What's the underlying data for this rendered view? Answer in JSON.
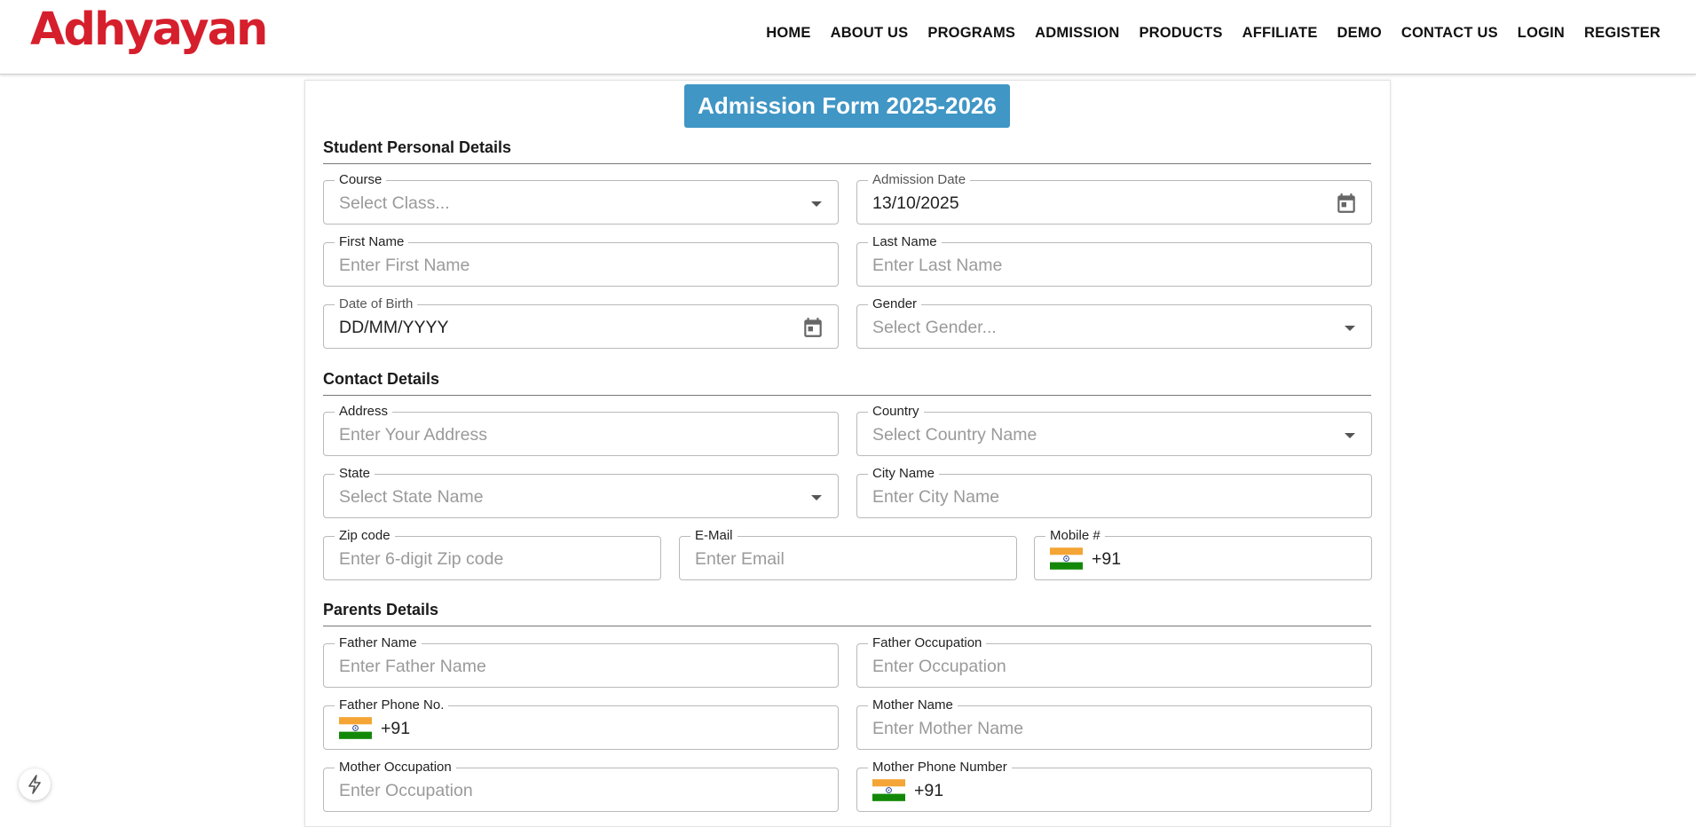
{
  "brand": {
    "logo_text": "Adhyayan",
    "color": "#d61f2c"
  },
  "nav": [
    "HOME",
    "ABOUT US",
    "PROGRAMS",
    "ADMISSION",
    "PRODUCTS",
    "AFFILIATE",
    "DEMO",
    "CONTACT US",
    "LOGIN",
    "REGISTER"
  ],
  "form_title": "Admission Form 2025-2026",
  "accent_color": "#4096c5",
  "sections": {
    "personal": {
      "title": "Student Personal Details",
      "course": {
        "label": "Course",
        "placeholder": "Select Class..."
      },
      "admission_date": {
        "label": "Admission Date",
        "value": "13/10/2025"
      },
      "first_name": {
        "label": "First Name",
        "placeholder": "Enter First Name"
      },
      "last_name": {
        "label": "Last Name",
        "placeholder": "Enter Last Name"
      },
      "dob": {
        "label": "Date of Birth",
        "value": "DD/MM/YYYY"
      },
      "gender": {
        "label": "Gender",
        "placeholder": "Select Gender..."
      }
    },
    "contact": {
      "title": "Contact Details",
      "address": {
        "label": "Address",
        "placeholder": "Enter Your Address"
      },
      "country": {
        "label": "Country",
        "placeholder": "Select Country Name"
      },
      "state": {
        "label": "State",
        "placeholder": "Select State Name"
      },
      "city": {
        "label": "City Name",
        "placeholder": "Enter City Name"
      },
      "zip": {
        "label": "Zip code",
        "placeholder": "Enter 6-digit Zip code"
      },
      "email": {
        "label": "E-Mail",
        "placeholder": "Enter Email"
      },
      "mobile": {
        "label": "Mobile #",
        "code": "+91"
      }
    },
    "parents": {
      "title": "Parents Details",
      "father_name": {
        "label": "Father Name",
        "placeholder": "Enter Father Name"
      },
      "father_occupation": {
        "label": "Father Occupation",
        "placeholder": "Enter Occupation"
      },
      "father_phone": {
        "label": "Father Phone No.",
        "code": "+91"
      },
      "mother_name": {
        "label": "Mother Name",
        "placeholder": "Enter Mother Name"
      },
      "mother_occupation": {
        "label": "Mother Occupation",
        "placeholder": "Enter Occupation"
      },
      "mother_phone": {
        "label": "Mother Phone Number",
        "code": "+91"
      }
    }
  },
  "icons": {
    "calendar": "calendar-icon",
    "dropdown": "chevron-down-icon",
    "flag": "india-flag-icon",
    "quick": "bolt-icon"
  }
}
